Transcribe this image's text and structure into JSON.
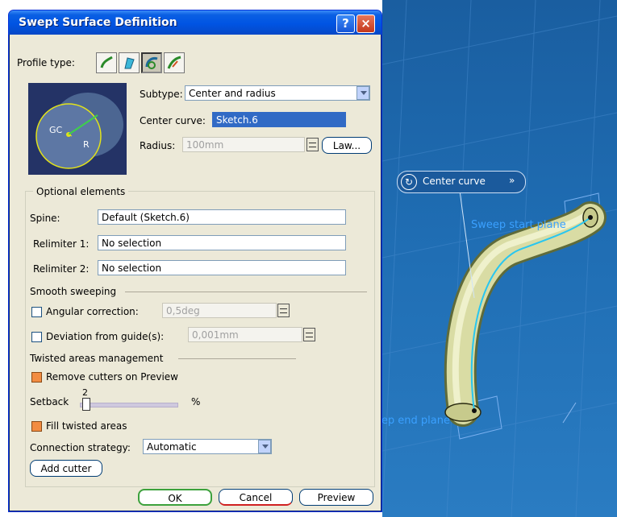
{
  "dialog": {
    "title": "Swept Surface Definition",
    "help_icon": "?",
    "close_icon": "×"
  },
  "profile": {
    "label": "Profile type:",
    "icons": [
      "explicit-profile-icon",
      "line-profile-icon",
      "circle-profile-icon",
      "conic-profile-icon"
    ],
    "selected_index": 2
  },
  "preview_image": {
    "gc_label": "GC",
    "r_label": "R"
  },
  "subtype": {
    "label": "Subtype:",
    "value": "Center and radius"
  },
  "center_curve": {
    "label": "Center curve:",
    "value": "Sketch.6"
  },
  "radius": {
    "label": "Radius:",
    "value": "100mm",
    "law_label": "Law..."
  },
  "optional": {
    "heading": "Optional elements",
    "spine_label": "Spine:",
    "spine_value": "Default (Sketch.6)",
    "relimiter1_label": "Relimiter 1:",
    "relimiter1_value": "No selection",
    "relimiter2_label": "Relimiter 2:",
    "relimiter2_value": "No selection"
  },
  "smooth": {
    "heading": "Smooth sweeping",
    "angular_label": "Angular correction:",
    "angular_value": "0,5deg",
    "deviation_label": "Deviation from guide(s):",
    "deviation_value": "0,001mm"
  },
  "twisted": {
    "heading": "Twisted areas management",
    "remove_cutters_label": "Remove cutters on Preview",
    "setback_label": "Setback",
    "setback_value": "2",
    "setback_unit": "%",
    "fill_label": "Fill twisted areas",
    "connection_label": "Connection strategy:",
    "connection_value": "Automatic",
    "add_cutter_label": "Add cutter"
  },
  "footer": {
    "ok": "OK",
    "cancel": "Cancel",
    "preview": "Preview"
  },
  "viewport": {
    "center_curve_tag": "Center curve",
    "tag_chevron": "»",
    "start_plane_label": "Sweep start plane",
    "end_plane_label": "Sweep end plane",
    "background": "#1f6db3"
  }
}
